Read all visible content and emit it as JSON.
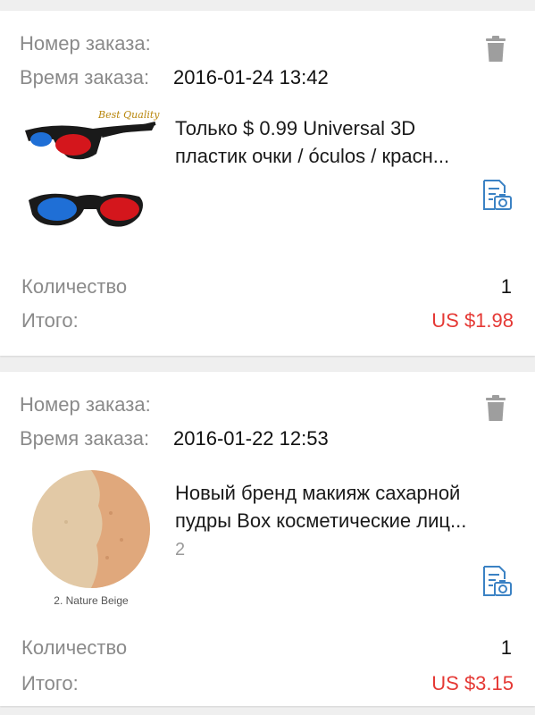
{
  "colors": {
    "label_gray": "#8a8a8a",
    "price_red": "#e53935",
    "icon_blue": "#3b82c4",
    "trash_gray": "#9e9e9e",
    "background": "#efefef"
  },
  "orders": [
    {
      "order_number_label": "Номер заказа:",
      "order_time_label": "Время заказа:",
      "order_time": "2016-01-24 13:42",
      "product_title_line1": "Только $ 0.99 Universal 3D",
      "product_title_line2": "пластик очки / óculos / красн...",
      "thumbnail": "3d-glasses-image",
      "thumbnail_text": "Best Quality",
      "quantity_label": "Количество",
      "quantity": "1",
      "total_label": "Итого:",
      "total": "US $1.98",
      "icons": {
        "delete": "trash-icon",
        "review": "review-camera-icon"
      }
    },
    {
      "order_number_label": "Номер заказа:",
      "order_time_label": "Время заказа:",
      "order_time": "2016-01-22 12:53",
      "product_title_line1": "Новый бренд макияж сахарной",
      "product_title_line2": "пудры Box косметические лиц...",
      "variant": "2",
      "thumbnail": "powder-image",
      "thumbnail_caption": "2. Nature Beige",
      "quantity_label": "Количество",
      "quantity": "1",
      "total_label": "Итого:",
      "total": "US $3.15",
      "icons": {
        "delete": "trash-icon",
        "review": "review-camera-icon"
      }
    }
  ]
}
